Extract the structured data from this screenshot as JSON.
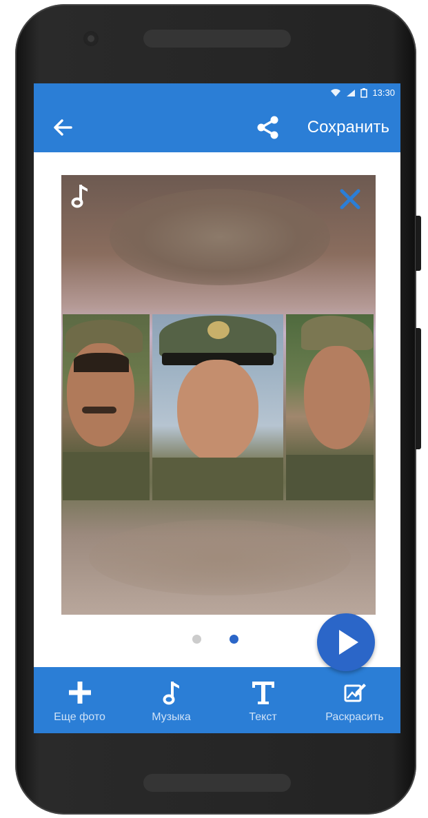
{
  "status_bar": {
    "time": "13:30"
  },
  "app_bar": {
    "save_label": "Сохранить"
  },
  "pager": {
    "count": 2,
    "active_index": 1
  },
  "toolbar": {
    "items": [
      {
        "label": "Еще фото",
        "icon": "plus-icon"
      },
      {
        "label": "Музыка",
        "icon": "music-note-icon"
      },
      {
        "label": "Текст",
        "icon": "text-icon"
      },
      {
        "label": "Раскрасить",
        "icon": "colorize-icon"
      }
    ]
  },
  "colors": {
    "primary": "#2b7ed6",
    "fab": "#2b66c8",
    "dot_active": "#2b66c8",
    "dot_inactive": "#cccccc",
    "close_x": "#2b7ed6"
  }
}
